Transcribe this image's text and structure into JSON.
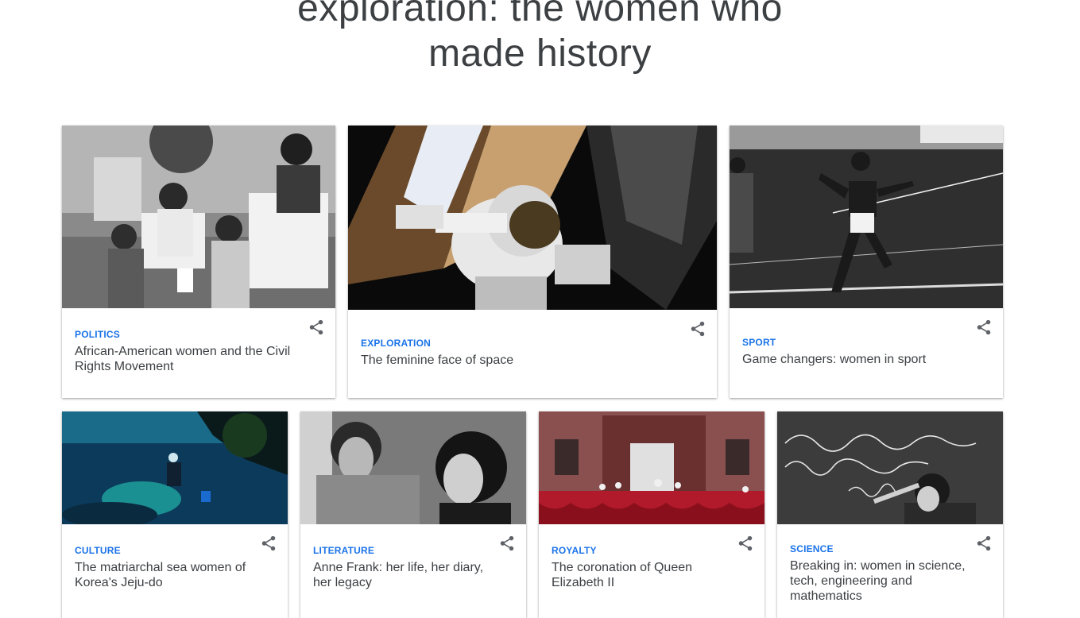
{
  "page": {
    "title_line1": "exploration: the women who",
    "title_line2": "made history"
  },
  "cards": [
    {
      "category": "POLITICS",
      "title": "African-American women and the Civil Rights Movement",
      "image": "civil-rights-march-photo",
      "share_icon": "share-icon"
    },
    {
      "category": "EXPLORATION",
      "title": "The feminine face of space",
      "image": "astronaut-spacewalk-photo",
      "share_icon": "share-icon"
    },
    {
      "category": "SPORT",
      "title": "Game changers: women in sport",
      "image": "sprinter-photo",
      "share_icon": "share-icon"
    },
    {
      "category": "CULTURE",
      "title": "The matriarchal sea women of Korea's Jeju-do",
      "image": "underwater-diver-photo",
      "share_icon": "share-icon"
    },
    {
      "category": "LITERATURE",
      "title": "Anne Frank: her life, her diary, her legacy",
      "image": "anne-frank-photo",
      "share_icon": "share-icon"
    },
    {
      "category": "ROYALTY",
      "title": "The coronation of Queen Elizabeth II",
      "image": "coronation-balcony-photo",
      "share_icon": "share-icon"
    },
    {
      "category": "SCIENCE",
      "title": "Breaking in: women in science, tech, engineering and mathematics",
      "image": "chalkboard-scientist-photo",
      "share_icon": "share-icon"
    }
  ],
  "colors": {
    "category": "#1a73e8",
    "title": "#3c4043",
    "share": "#5f6368"
  }
}
